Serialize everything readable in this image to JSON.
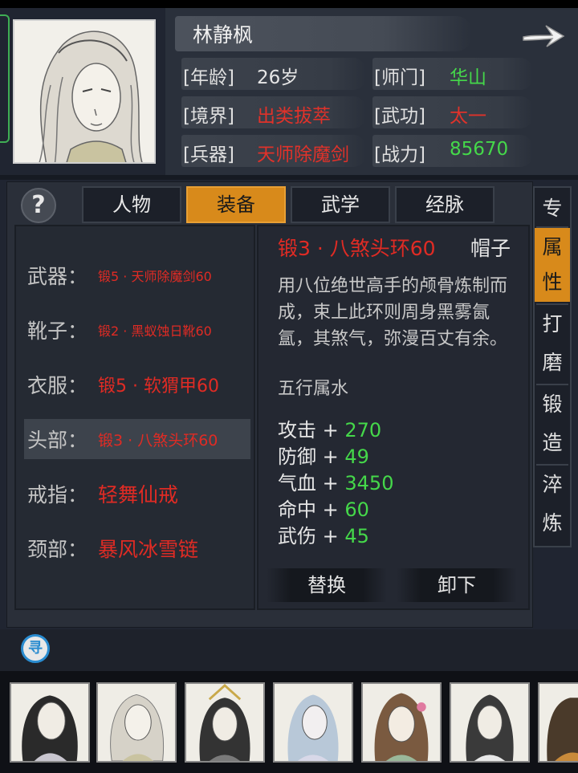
{
  "character": {
    "name": "林静枫",
    "stats": [
      {
        "label": "[年龄]",
        "value": "26岁",
        "color": "default"
      },
      {
        "label": "[师门]",
        "value": "华山",
        "color": "green"
      },
      {
        "label": "[境界]",
        "value": "出类拔萃",
        "color": "red"
      },
      {
        "label": "[武功]",
        "value": "太一",
        "color": "red"
      },
      {
        "label": "[兵器]",
        "value": "天师除魔剑",
        "color": "red"
      },
      {
        "label": "[战力]",
        "value": "85670",
        "color": "green"
      }
    ]
  },
  "help_label": "?",
  "tabs": [
    "人物",
    "装备",
    "武学",
    "经脉"
  ],
  "active_tab": "装备",
  "equipment": [
    {
      "slot": "武器：",
      "item": "锻5 · 天师除魔剑60"
    },
    {
      "slot": "靴子：",
      "item": "锻2 · 黑蚁蚀日靴60"
    },
    {
      "slot": "衣服：",
      "item": "锻5 · 软猬甲60"
    },
    {
      "slot": "头部：",
      "item": "锻3 · 八煞头环60"
    },
    {
      "slot": "戒指：",
      "item": "轻舞仙戒"
    },
    {
      "slot": "颈部：",
      "item": "暴风冰雪链"
    }
  ],
  "detail": {
    "title": "锻3 · 八煞头环60",
    "type": "帽子",
    "description": "用八位绝世高手的颅骨炼制而成，束上此环则周身黑雾氤氲，其煞气，弥漫百丈有余。",
    "element": "五行属水",
    "attributes": [
      {
        "name": "攻击",
        "op": "+",
        "value": "270"
      },
      {
        "name": "防御",
        "op": "+",
        "value": "49"
      },
      {
        "name": "气血",
        "op": "+",
        "value": "3450"
      },
      {
        "name": "命中",
        "op": "+",
        "value": "60"
      },
      {
        "name": "武伤",
        "op": "+",
        "value": "45"
      }
    ],
    "actions": {
      "replace": "替换",
      "unequip": "卸下"
    }
  },
  "side_tabs": [
    "专",
    "属性",
    "打磨",
    "锻造",
    "淬炼"
  ],
  "search_label": "寻",
  "colors": {
    "accent": "#d88a1b",
    "green": "#45d84a",
    "red": "#e02b24"
  }
}
